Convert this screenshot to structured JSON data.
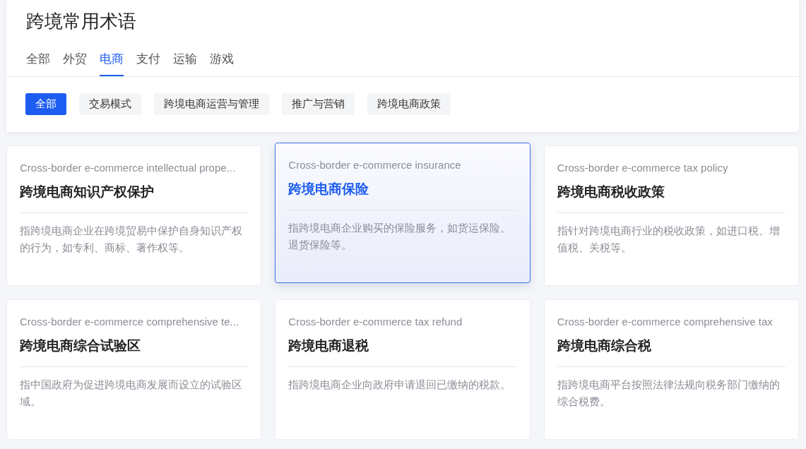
{
  "page_title": "跨境常用术语",
  "tabs": [
    {
      "label": "全部",
      "selected": false
    },
    {
      "label": "外贸",
      "selected": false
    },
    {
      "label": "电商",
      "selected": true
    },
    {
      "label": "支付",
      "selected": false
    },
    {
      "label": "运输",
      "selected": false
    },
    {
      "label": "游戏",
      "selected": false
    }
  ],
  "filters": [
    {
      "label": "全部",
      "selected": true
    },
    {
      "label": "交易模式",
      "selected": false
    },
    {
      "label": "跨境电商运营与管理",
      "selected": false
    },
    {
      "label": "推广与营销",
      "selected": false
    },
    {
      "label": "跨境电商政策",
      "selected": false
    }
  ],
  "cards": [
    {
      "english": "Cross-border e-commerce intellectual prope...",
      "title": "跨境电商知识产权保护",
      "description": "指跨境电商企业在跨境贸易中保护自身知识产权的行为，如专利、商标、著作权等。",
      "selected": false
    },
    {
      "english": "Cross-border e-commerce insurance",
      "title": "跨境电商保险",
      "description": "指跨境电商企业购买的保险服务，如货运保险、退货保险等。",
      "selected": true
    },
    {
      "english": "Cross-border e-commerce tax policy",
      "title": "跨境电商税收政策",
      "description": "指针对跨境电商行业的税收政策，如进口税、增值税、关税等。",
      "selected": false
    },
    {
      "english": "Cross-border e-commerce comprehensive te...",
      "title": "跨境电商综合试验区",
      "description": "指中国政府为促进跨境电商发展而设立的试验区域。",
      "selected": false
    },
    {
      "english": "Cross-border e-commerce tax refund",
      "title": "跨境电商退税",
      "description": "指跨境电商企业向政府申请退回已缴纳的税款。",
      "selected": false
    },
    {
      "english": "Cross-border e-commerce comprehensive tax",
      "title": "跨境电商综合税",
      "description": "指跨境电商平台按照法律法规向税务部门缴纳的综合税费。",
      "selected": false
    }
  ]
}
